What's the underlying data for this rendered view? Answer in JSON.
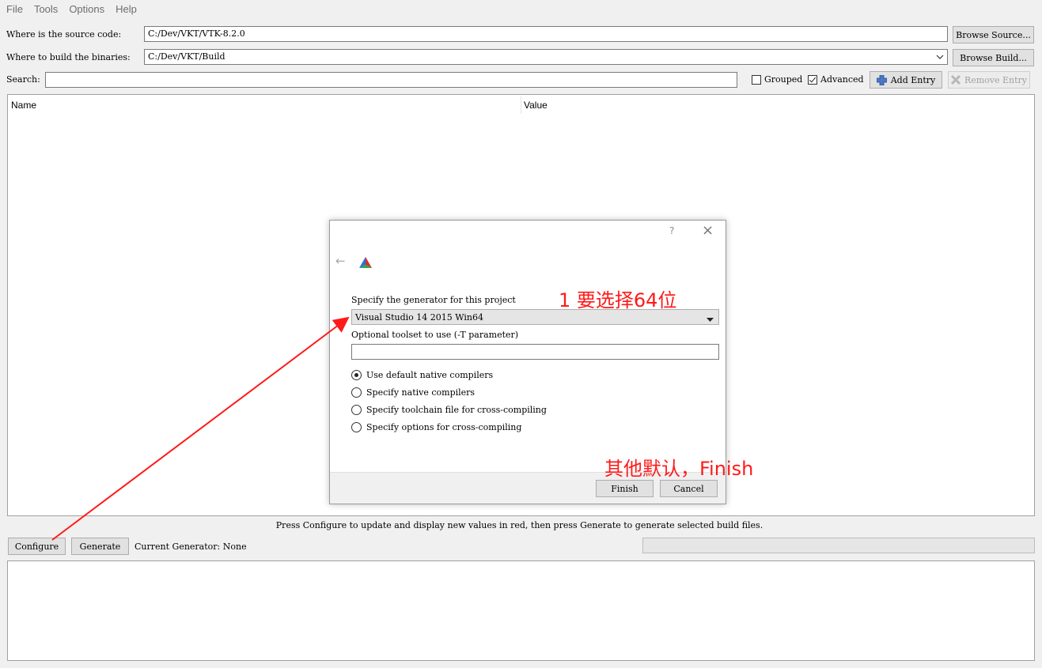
{
  "menu": [
    "File",
    "Tools",
    "Options",
    "Help"
  ],
  "source": {
    "label": "Where is the source code:",
    "value": "C:/Dev/VKT/VTK-8.2.0",
    "browse": "Browse Source..."
  },
  "build": {
    "label": "Where to build the binaries:",
    "value": "C:/Dev/VKT/Build",
    "browse": "Browse Build..."
  },
  "search": {
    "label": "Search:",
    "value": ""
  },
  "options": {
    "grouped": "Grouped",
    "advanced": "Advanced",
    "add_entry": "Add Entry",
    "remove_entry": "Remove Entry"
  },
  "table": {
    "col_name": "Name",
    "col_value": "Value"
  },
  "status": "Press Configure to update and display new values in red, then press Generate to generate selected build files.",
  "bottom": {
    "configure": "Configure",
    "generate": "Generate",
    "current_generator": "Current Generator: None"
  },
  "dialog": {
    "help": "?",
    "close": "×",
    "back": "←",
    "generator_label": "Specify the generator for this project",
    "generator_value": "Visual Studio 14 2015 Win64",
    "toolset_label": "Optional toolset to use (-T parameter)",
    "toolset_value": "",
    "radios": [
      "Use default native compilers",
      "Specify native compilers",
      "Specify toolchain file for cross-compiling",
      "Specify options for cross-compiling"
    ],
    "finish": "Finish",
    "cancel": "Cancel"
  },
  "annotations": {
    "note1": "1 要选择64位",
    "note2": "其他默认，Finish",
    "color": "#ff1a1a"
  }
}
